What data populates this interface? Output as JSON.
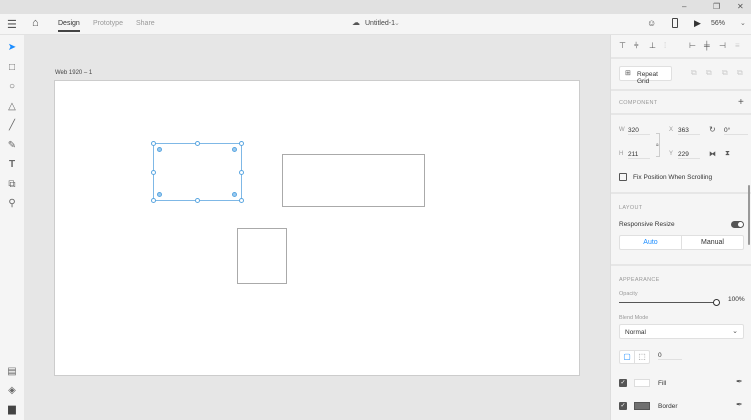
{
  "window": {
    "minimize": "–",
    "maximize": "❐",
    "close": "✕"
  },
  "appbar": {
    "tabs": [
      {
        "label": "Design",
        "active": true
      },
      {
        "label": "Prototype"
      },
      {
        "label": "Share"
      }
    ],
    "doc_title": "Untitled-1",
    "zoom": "56%"
  },
  "artboard": {
    "name": "Web 1920 – 1"
  },
  "panel": {
    "repeat_grid": "Repeat Grid",
    "component_header": "COMPONENT",
    "w_label": "W",
    "w": "320",
    "x_label": "X",
    "x": "363",
    "rotation": "0°",
    "h_label": "H",
    "h": "211",
    "y_label": "Y",
    "y": "229",
    "fix_position": "Fix Position When Scrolling",
    "layout_header": "LAYOUT",
    "responsive_resize": "Responsive Resize",
    "responsive_on": true,
    "auto": "Auto",
    "manual": "Manual",
    "appearance_header": "APPEARANCE",
    "opacity_label": "Opacity",
    "opacity": "100%",
    "opacity_value": 1.0,
    "blend_label": "Blend Mode",
    "blend": "Normal",
    "corner_radius": "0",
    "fill_label": "Fill",
    "fill_color": "#ffffff",
    "border_label": "Border",
    "border_color": "#707070"
  },
  "colors": {
    "accent": "#1a8cff",
    "selection": "#7fb8e6"
  }
}
